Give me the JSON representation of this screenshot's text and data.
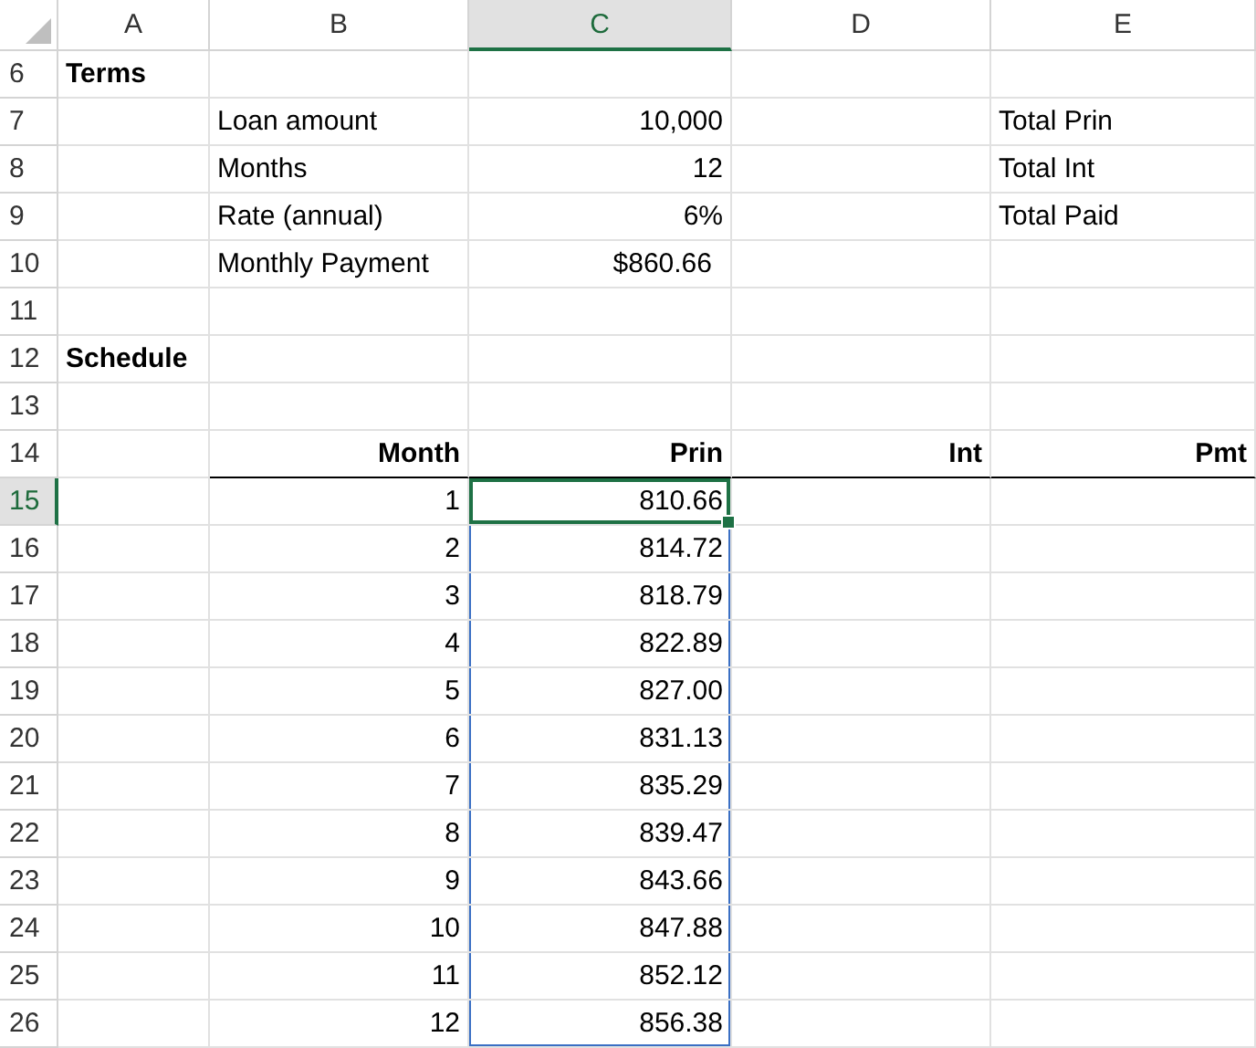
{
  "columns": [
    {
      "label": "A",
      "selected": false
    },
    {
      "label": "B",
      "selected": false
    },
    {
      "label": "C",
      "selected": true
    },
    {
      "label": "D",
      "selected": false
    },
    {
      "label": "E",
      "selected": false
    }
  ],
  "rows": [
    {
      "num": "6",
      "selected": false,
      "cells": [
        {
          "text": "Terms",
          "kind": "title",
          "selected": false
        },
        null,
        null,
        null,
        null
      ]
    },
    {
      "num": "7",
      "selected": false,
      "cells": [
        null,
        {
          "text": "Loan amount",
          "kind": "text",
          "selected": false
        },
        {
          "text": "10,000",
          "kind": "number",
          "selected": false
        },
        null,
        {
          "text": "Total Prin",
          "kind": "text",
          "selected": false
        }
      ]
    },
    {
      "num": "8",
      "selected": false,
      "cells": [
        null,
        {
          "text": "Months",
          "kind": "text",
          "selected": false
        },
        {
          "text": "12",
          "kind": "number",
          "selected": false
        },
        null,
        {
          "text": "Total Int",
          "kind": "text",
          "selected": false
        }
      ]
    },
    {
      "num": "9",
      "selected": false,
      "cells": [
        null,
        {
          "text": "Rate (annual)",
          "kind": "text",
          "selected": false
        },
        {
          "text": "6%",
          "kind": "number",
          "selected": false
        },
        null,
        {
          "text": "Total Paid",
          "kind": "text",
          "selected": false
        }
      ]
    },
    {
      "num": "10",
      "selected": false,
      "cells": [
        null,
        {
          "text": "Monthly Payment",
          "kind": "text",
          "selected": false
        },
        {
          "text": "$860.66",
          "kind": "currency",
          "selected": false
        },
        null,
        null
      ]
    },
    {
      "num": "11",
      "selected": false,
      "cells": [
        null,
        null,
        null,
        null,
        null
      ]
    },
    {
      "num": "12",
      "selected": false,
      "cells": [
        {
          "text": "Schedule",
          "kind": "title",
          "selected": false
        },
        null,
        null,
        null,
        null
      ]
    },
    {
      "num": "13",
      "selected": false,
      "cells": [
        null,
        null,
        null,
        null,
        null
      ]
    },
    {
      "num": "14",
      "selected": false,
      "cells": [
        null,
        {
          "text": "Month",
          "kind": "heading",
          "selected": false
        },
        {
          "text": "Prin",
          "kind": "heading",
          "selected": false
        },
        {
          "text": "Int",
          "kind": "heading",
          "selected": false
        },
        {
          "text": "Pmt",
          "kind": "heading",
          "selected": false
        }
      ]
    },
    {
      "num": "15",
      "selected": true,
      "cells": [
        null,
        {
          "text": "1",
          "kind": "number",
          "selected": false
        },
        {
          "text": "810.66",
          "kind": "number",
          "active": true
        },
        null,
        null
      ]
    },
    {
      "num": "16",
      "selected": false,
      "cells": [
        null,
        {
          "text": "2",
          "kind": "number",
          "selected": false
        },
        {
          "text": "814.72",
          "kind": "number",
          "selected": true,
          "active": false
        },
        null,
        null
      ]
    },
    {
      "num": "17",
      "selected": false,
      "cells": [
        null,
        {
          "text": "3",
          "kind": "number",
          "selected": false
        },
        {
          "text": "818.79",
          "kind": "number",
          "selected": true,
          "active": false
        },
        null,
        null
      ]
    },
    {
      "num": "18",
      "selected": false,
      "cells": [
        null,
        {
          "text": "4",
          "kind": "number",
          "selected": false
        },
        {
          "text": "822.89",
          "kind": "number",
          "selected": true,
          "active": false
        },
        null,
        null
      ]
    },
    {
      "num": "19",
      "selected": false,
      "cells": [
        null,
        {
          "text": "5",
          "kind": "number",
          "selected": false
        },
        {
          "text": "827.00",
          "kind": "number",
          "selected": true,
          "active": false
        },
        null,
        null
      ]
    },
    {
      "num": "20",
      "selected": false,
      "cells": [
        null,
        {
          "text": "6",
          "kind": "number",
          "selected": false
        },
        {
          "text": "831.13",
          "kind": "number",
          "selected": true,
          "active": false
        },
        null,
        null
      ]
    },
    {
      "num": "21",
      "selected": false,
      "cells": [
        null,
        {
          "text": "7",
          "kind": "number",
          "selected": false
        },
        {
          "text": "835.29",
          "kind": "number",
          "selected": true,
          "active": false
        },
        null,
        null
      ]
    },
    {
      "num": "22",
      "selected": false,
      "cells": [
        null,
        {
          "text": "8",
          "kind": "number",
          "selected": false
        },
        {
          "text": "839.47",
          "kind": "number",
          "selected": true,
          "active": false
        },
        null,
        null
      ]
    },
    {
      "num": "23",
      "selected": false,
      "cells": [
        null,
        {
          "text": "9",
          "kind": "number",
          "selected": false
        },
        {
          "text": "843.66",
          "kind": "number",
          "selected": true,
          "active": false
        },
        null,
        null
      ]
    },
    {
      "num": "24",
      "selected": false,
      "cells": [
        null,
        {
          "text": "10",
          "kind": "number",
          "selected": false
        },
        {
          "text": "847.88",
          "kind": "number",
          "selected": true,
          "active": false
        },
        null,
        null
      ]
    },
    {
      "num": "25",
      "selected": false,
      "cells": [
        null,
        {
          "text": "11",
          "kind": "number",
          "selected": false
        },
        {
          "text": "852.12",
          "kind": "number",
          "selected": true,
          "active": false
        },
        null,
        null
      ]
    },
    {
      "num": "26",
      "selected": false,
      "cells": [
        null,
        {
          "text": "12",
          "kind": "number",
          "selected": false
        },
        {
          "text": "856.38",
          "kind": "number",
          "selected": true,
          "active": false
        },
        null,
        null
      ]
    }
  ]
}
